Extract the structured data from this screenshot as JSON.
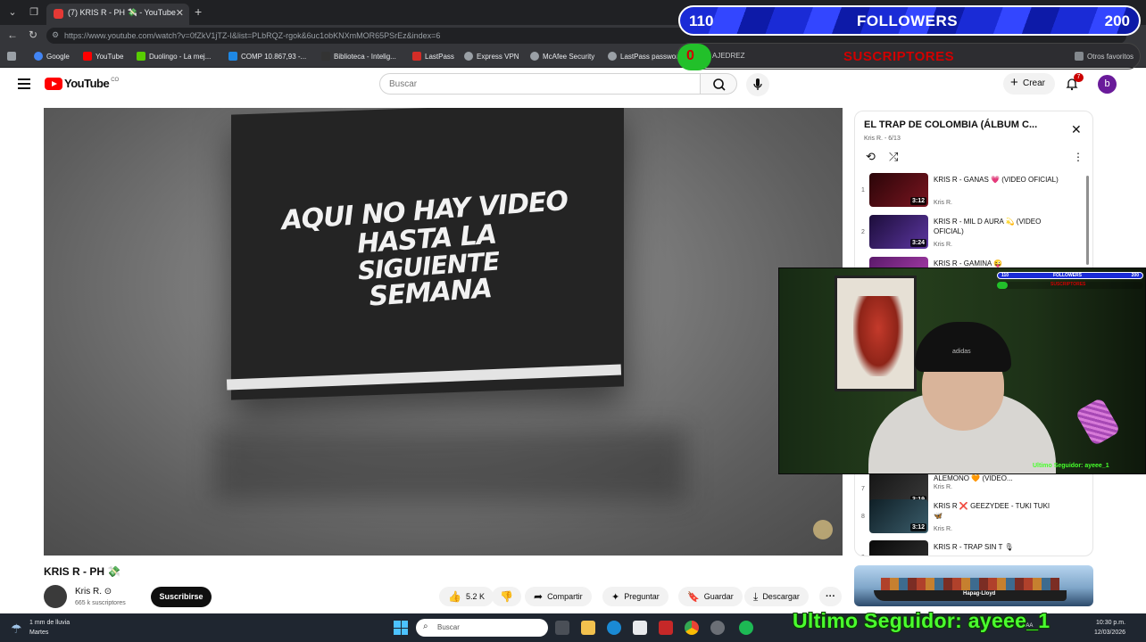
{
  "browser": {
    "tab_title": "(7) KRIS R - PH 💸 - YouTube",
    "url": "https://www.youtube.com/watch?v=0fZkV1jTZ-I&list=PLbRQZ-rgok&6uc1obKNXmMOR65PSrEz&index=6",
    "bookmarks": [
      {
        "label": "Google",
        "color": "#4285f4"
      },
      {
        "label": "YouTube",
        "color": "#ff0000"
      },
      {
        "label": "Duolingo - La mej...",
        "color": "#58cc02"
      },
      {
        "label": "COMP 10.867,93 -...",
        "color": "#1e88e5"
      },
      {
        "label": "Biblioteca - Intelig...",
        "color": "#333333"
      },
      {
        "label": "LastPass",
        "color": "#d32d27"
      },
      {
        "label": "Express VPN",
        "color": "#9aa0a6"
      },
      {
        "label": "McAfee Security",
        "color": "#9aa0a6"
      },
      {
        "label": "LastPass password...",
        "color": "#9aa0a6"
      },
      {
        "label": "AJEDREZ",
        "color": "#9aa0a6"
      }
    ],
    "other_favorites": "Otros favoritos"
  },
  "overlay": {
    "followers_current": "110",
    "followers_label": "FOLLOWERS",
    "followers_goal": "200",
    "subs_current": "0",
    "subs_label": "SUSCRIPTORES",
    "last_follower": "Ultimo Seguidor: ayeee_1",
    "webcam_last_follower": "Ultimo Seguidor: ayeee_1",
    "webcam_followers_current": "110",
    "webcam_followers_label": "FOLLOWERS",
    "webcam_followers_goal": "200",
    "webcam_subs_label": "SUSCRIPTORES",
    "cap_logo": "adidas"
  },
  "youtube": {
    "logo_text": "YouTube",
    "logo_region": "CO",
    "search_placeholder": "Buscar",
    "create_label": "Crear",
    "notification_count": "7",
    "avatar_letter": "b"
  },
  "video": {
    "flag_line1": "AQUI NO HAY VIDEO HASTA LA",
    "flag_line2": "SIGUIENTE",
    "flag_line3": "SEMANA",
    "title": "KRIS R - PH 💸",
    "channel": "Kris R. ⊙",
    "channel_subs": "665 k suscriptores",
    "subscribe_label": "Suscribirse",
    "likes": "5.2 K",
    "share_label": "Compartir",
    "ask_label": "Preguntar",
    "save_label": "Guardar",
    "download_label": "Descargar"
  },
  "playlist": {
    "title": "EL TRAP DE COLOMBIA (ÁLBUM C...",
    "meta": "Kris R. - 6/13",
    "items": [
      {
        "index": "1",
        "title": "KRIS R - GANAS 💗 (VIDEO OFICIAL)",
        "channel": "Kris R.",
        "duration": "3:12",
        "color": "#5a0d14"
      },
      {
        "index": "2",
        "title": "KRIS R - MIL D AURA 💫 (VIDEO OFICIAL)",
        "channel": "Kris R.",
        "duration": "3:24",
        "color": "#3d1f6b"
      },
      {
        "index": "3",
        "title": "KRIS R - GAMINA 😜",
        "channel": "",
        "duration": "",
        "color": "#8a2a8a"
      },
      {
        "index": "7",
        "title": "ALEMONO 🧡 (VIDEO...",
        "channel": "Kris R.",
        "duration": "3:19",
        "color": "#2b2b2b"
      },
      {
        "index": "8",
        "title": "KRIS R ❌ GEEZYDEE - TUKI TUKI 🦋",
        "channel": "Kris R.",
        "duration": "3:12",
        "color": "#233a44"
      },
      {
        "index": "9",
        "title": "KRIS R - TRAP SIN T 🎙",
        "channel": "",
        "duration": "",
        "color": "#1c1c1c"
      }
    ]
  },
  "ad": {
    "brand": "Hapag-Lloyd"
  },
  "taskbar": {
    "weather_line1": "1 mm de lluvia",
    "weather_line2": "Martes",
    "search_placeholder": "Buscar",
    "tray_lang": "LAA",
    "time": "10:30 p.m.",
    "date": "12/03/2026"
  }
}
